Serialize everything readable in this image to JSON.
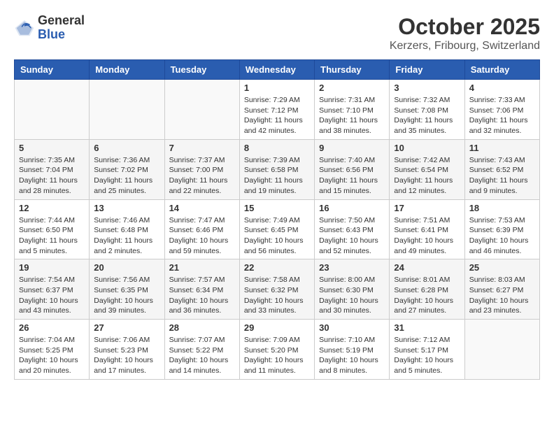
{
  "header": {
    "logo_general": "General",
    "logo_blue": "Blue",
    "month": "October 2025",
    "location": "Kerzers, Fribourg, Switzerland"
  },
  "weekdays": [
    "Sunday",
    "Monday",
    "Tuesday",
    "Wednesday",
    "Thursday",
    "Friday",
    "Saturday"
  ],
  "weeks": [
    [
      {
        "day": "",
        "info": ""
      },
      {
        "day": "",
        "info": ""
      },
      {
        "day": "",
        "info": ""
      },
      {
        "day": "1",
        "info": "Sunrise: 7:29 AM\nSunset: 7:12 PM\nDaylight: 11 hours\nand 42 minutes."
      },
      {
        "day": "2",
        "info": "Sunrise: 7:31 AM\nSunset: 7:10 PM\nDaylight: 11 hours\nand 38 minutes."
      },
      {
        "day": "3",
        "info": "Sunrise: 7:32 AM\nSunset: 7:08 PM\nDaylight: 11 hours\nand 35 minutes."
      },
      {
        "day": "4",
        "info": "Sunrise: 7:33 AM\nSunset: 7:06 PM\nDaylight: 11 hours\nand 32 minutes."
      }
    ],
    [
      {
        "day": "5",
        "info": "Sunrise: 7:35 AM\nSunset: 7:04 PM\nDaylight: 11 hours\nand 28 minutes."
      },
      {
        "day": "6",
        "info": "Sunrise: 7:36 AM\nSunset: 7:02 PM\nDaylight: 11 hours\nand 25 minutes."
      },
      {
        "day": "7",
        "info": "Sunrise: 7:37 AM\nSunset: 7:00 PM\nDaylight: 11 hours\nand 22 minutes."
      },
      {
        "day": "8",
        "info": "Sunrise: 7:39 AM\nSunset: 6:58 PM\nDaylight: 11 hours\nand 19 minutes."
      },
      {
        "day": "9",
        "info": "Sunrise: 7:40 AM\nSunset: 6:56 PM\nDaylight: 11 hours\nand 15 minutes."
      },
      {
        "day": "10",
        "info": "Sunrise: 7:42 AM\nSunset: 6:54 PM\nDaylight: 11 hours\nand 12 minutes."
      },
      {
        "day": "11",
        "info": "Sunrise: 7:43 AM\nSunset: 6:52 PM\nDaylight: 11 hours\nand 9 minutes."
      }
    ],
    [
      {
        "day": "12",
        "info": "Sunrise: 7:44 AM\nSunset: 6:50 PM\nDaylight: 11 hours\nand 5 minutes."
      },
      {
        "day": "13",
        "info": "Sunrise: 7:46 AM\nSunset: 6:48 PM\nDaylight: 11 hours\nand 2 minutes."
      },
      {
        "day": "14",
        "info": "Sunrise: 7:47 AM\nSunset: 6:46 PM\nDaylight: 10 hours\nand 59 minutes."
      },
      {
        "day": "15",
        "info": "Sunrise: 7:49 AM\nSunset: 6:45 PM\nDaylight: 10 hours\nand 56 minutes."
      },
      {
        "day": "16",
        "info": "Sunrise: 7:50 AM\nSunset: 6:43 PM\nDaylight: 10 hours\nand 52 minutes."
      },
      {
        "day": "17",
        "info": "Sunrise: 7:51 AM\nSunset: 6:41 PM\nDaylight: 10 hours\nand 49 minutes."
      },
      {
        "day": "18",
        "info": "Sunrise: 7:53 AM\nSunset: 6:39 PM\nDaylight: 10 hours\nand 46 minutes."
      }
    ],
    [
      {
        "day": "19",
        "info": "Sunrise: 7:54 AM\nSunset: 6:37 PM\nDaylight: 10 hours\nand 43 minutes."
      },
      {
        "day": "20",
        "info": "Sunrise: 7:56 AM\nSunset: 6:35 PM\nDaylight: 10 hours\nand 39 minutes."
      },
      {
        "day": "21",
        "info": "Sunrise: 7:57 AM\nSunset: 6:34 PM\nDaylight: 10 hours\nand 36 minutes."
      },
      {
        "day": "22",
        "info": "Sunrise: 7:58 AM\nSunset: 6:32 PM\nDaylight: 10 hours\nand 33 minutes."
      },
      {
        "day": "23",
        "info": "Sunrise: 8:00 AM\nSunset: 6:30 PM\nDaylight: 10 hours\nand 30 minutes."
      },
      {
        "day": "24",
        "info": "Sunrise: 8:01 AM\nSunset: 6:28 PM\nDaylight: 10 hours\nand 27 minutes."
      },
      {
        "day": "25",
        "info": "Sunrise: 8:03 AM\nSunset: 6:27 PM\nDaylight: 10 hours\nand 23 minutes."
      }
    ],
    [
      {
        "day": "26",
        "info": "Sunrise: 7:04 AM\nSunset: 5:25 PM\nDaylight: 10 hours\nand 20 minutes."
      },
      {
        "day": "27",
        "info": "Sunrise: 7:06 AM\nSunset: 5:23 PM\nDaylight: 10 hours\nand 17 minutes."
      },
      {
        "day": "28",
        "info": "Sunrise: 7:07 AM\nSunset: 5:22 PM\nDaylight: 10 hours\nand 14 minutes."
      },
      {
        "day": "29",
        "info": "Sunrise: 7:09 AM\nSunset: 5:20 PM\nDaylight: 10 hours\nand 11 minutes."
      },
      {
        "day": "30",
        "info": "Sunrise: 7:10 AM\nSunset: 5:19 PM\nDaylight: 10 hours\nand 8 minutes."
      },
      {
        "day": "31",
        "info": "Sunrise: 7:12 AM\nSunset: 5:17 PM\nDaylight: 10 hours\nand 5 minutes."
      },
      {
        "day": "",
        "info": ""
      }
    ]
  ]
}
